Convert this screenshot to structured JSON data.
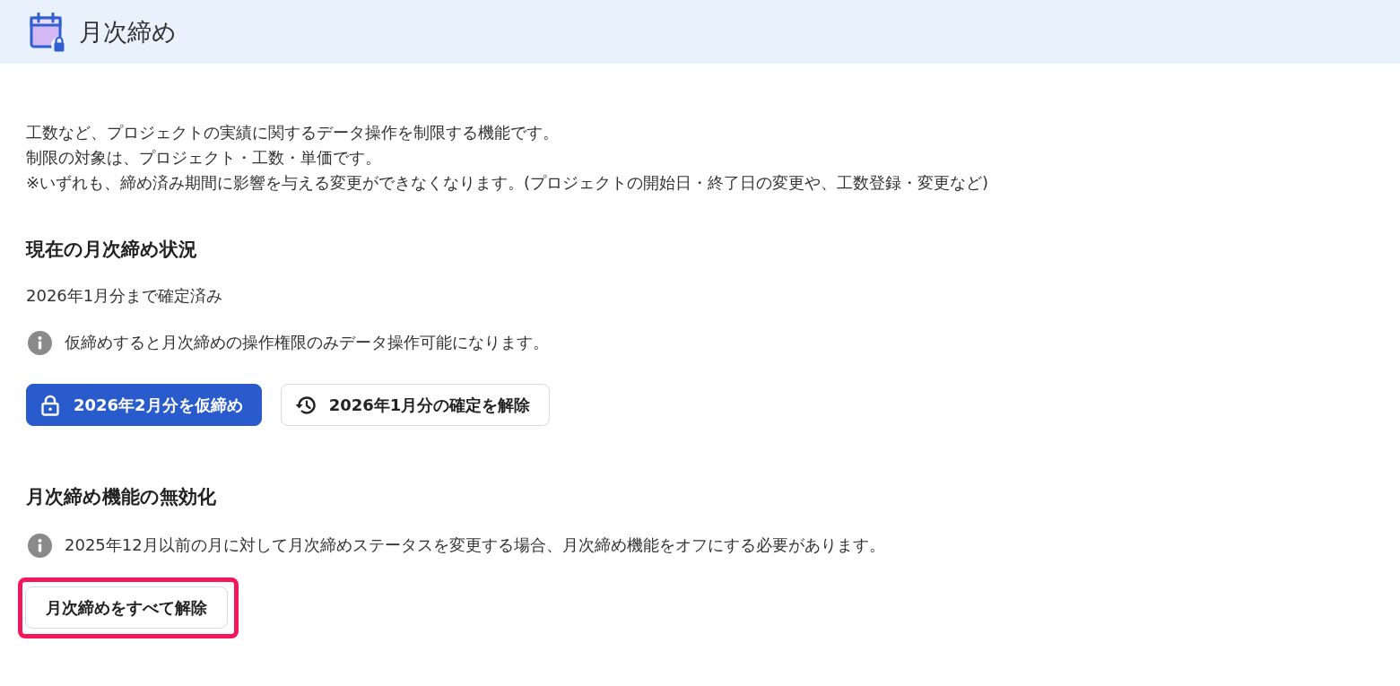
{
  "header": {
    "title": "月次締め"
  },
  "intro": [
    "工数など、プロジェクトの実績に関するデータ操作を制限する機能です。",
    "制限の対象は、プロジェクト・工数・単価です。",
    "※いずれも、締め済み期間に影響を与える変更ができなくなります。(プロジェクトの開始日・終了日の変更や、工数登録・変更など)"
  ],
  "sections": [
    {
      "heading": "現在の月次締め状況",
      "status": "2026年1月分まで確定済み",
      "note": "仮締めすると月次締めの操作権限のみデータ操作可能になります。",
      "buttons": [
        {
          "label": "2026年2月分を仮締め",
          "kind": "primary",
          "highlighted": false
        },
        {
          "label": "2026年1月分の確定を解除",
          "kind": "revert",
          "highlighted": false
        }
      ]
    },
    {
      "heading": "月次締め機能の無効化",
      "note": "2025年12月以前の月に対して月次締めステータスを変更する場合、月次締め機能をオフにする必要があります。",
      "buttons": [
        {
          "label": "月次締めをすべて解除",
          "kind": "plain",
          "highlighted": true
        }
      ]
    }
  ]
}
